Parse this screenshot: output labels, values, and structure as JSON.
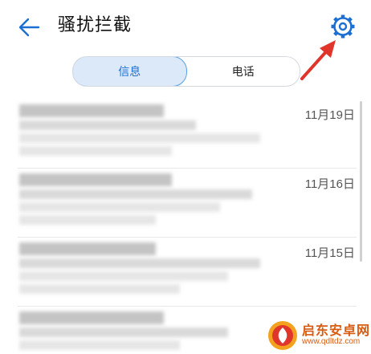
{
  "header": {
    "title": "骚扰拦截"
  },
  "tabs": [
    {
      "label": "信息",
      "selected": true
    },
    {
      "label": "电话",
      "selected": false
    }
  ],
  "messages": [
    {
      "date": "11月19日"
    },
    {
      "date": "11月16日"
    },
    {
      "date": "11月15日"
    }
  ],
  "watermark": {
    "name": "启东安卓网",
    "url": "www.qdltdz.com"
  },
  "colors": {
    "accent": "#1d6fd1",
    "tab_active_bg": "#dbe9f8",
    "annotation_arrow": "#e0352b",
    "watermark": "#d85b12"
  }
}
